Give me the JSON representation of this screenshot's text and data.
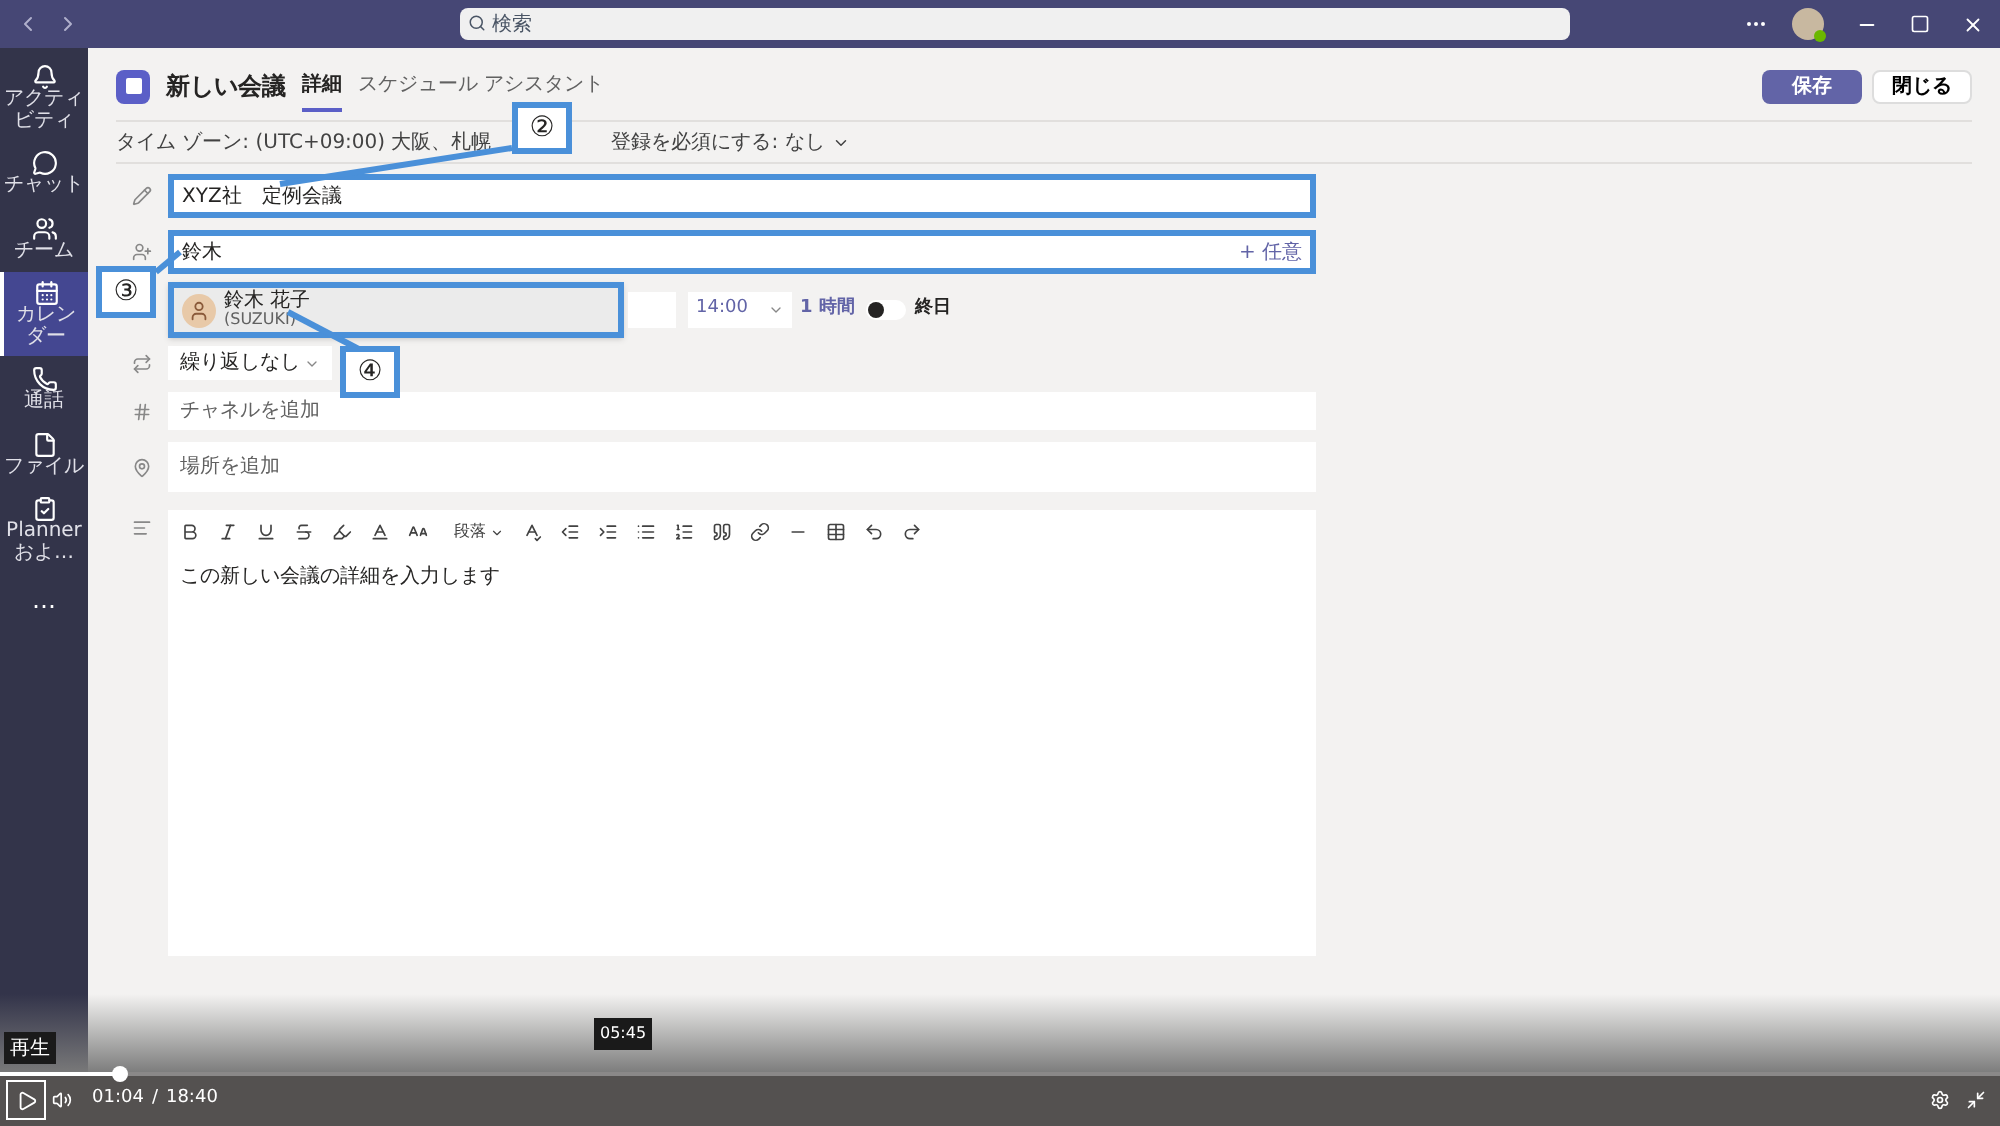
{
  "title_bar": {
    "search": {
      "placeholder": "検索"
    }
  },
  "rail": {
    "items": [
      {
        "kind": "bell",
        "label": "アクティビティ",
        "selected": false
      },
      {
        "kind": "chat",
        "label": "チャット",
        "selected": false
      },
      {
        "kind": "team",
        "label": "チーム",
        "selected": false
      },
      {
        "kind": "calendar",
        "label": "カレンダー",
        "selected": true
      },
      {
        "kind": "phone",
        "label": "通話",
        "selected": false
      },
      {
        "kind": "file",
        "label": "ファイル",
        "selected": false
      },
      {
        "kind": "planner",
        "label": "Planner およ…",
        "selected": false
      },
      {
        "kind": "more",
        "label": "…",
        "selected": false
      }
    ]
  },
  "header": {
    "title": "新しい会議",
    "tabs": [
      {
        "label": "詳細",
        "selected": true
      },
      {
        "label": "スケジュール アシスタント",
        "selected": false
      }
    ],
    "save": "保存",
    "close": "閉じる"
  },
  "options_row": {
    "timezone": "タイム ゾーン: (UTC+09:00) 大阪、札幌",
    "registration": "登録を必須にする: なし"
  },
  "title_field": {
    "value": "XYZ社　定例会議",
    "highlighted": true
  },
  "attendees_field": {
    "value": "鈴木",
    "optional": "+ 任意",
    "highlighted": true
  },
  "suggestion": {
    "name": "鈴木 花子",
    "detail": "(SUZUKI)",
    "highlighted": true
  },
  "time_row": {
    "start_time": "14:00",
    "duration": "1 時間",
    "all_day": {
      "label": "終日",
      "on": false
    }
  },
  "repeat": "繰り返しなし",
  "channel_placeholder": "チャネルを追加",
  "location_placeholder": "場所を追加",
  "editor": {
    "paragraph_style": "段落",
    "placeholder": "この新しい会議の詳細を入力します"
  },
  "callouts": [
    "②",
    "③",
    "④"
  ],
  "player": {
    "play_tooltip": "再生",
    "hover_time": "05:45",
    "level": 0.06,
    "current": "01:04",
    "separator": "/",
    "total": "18:40"
  }
}
